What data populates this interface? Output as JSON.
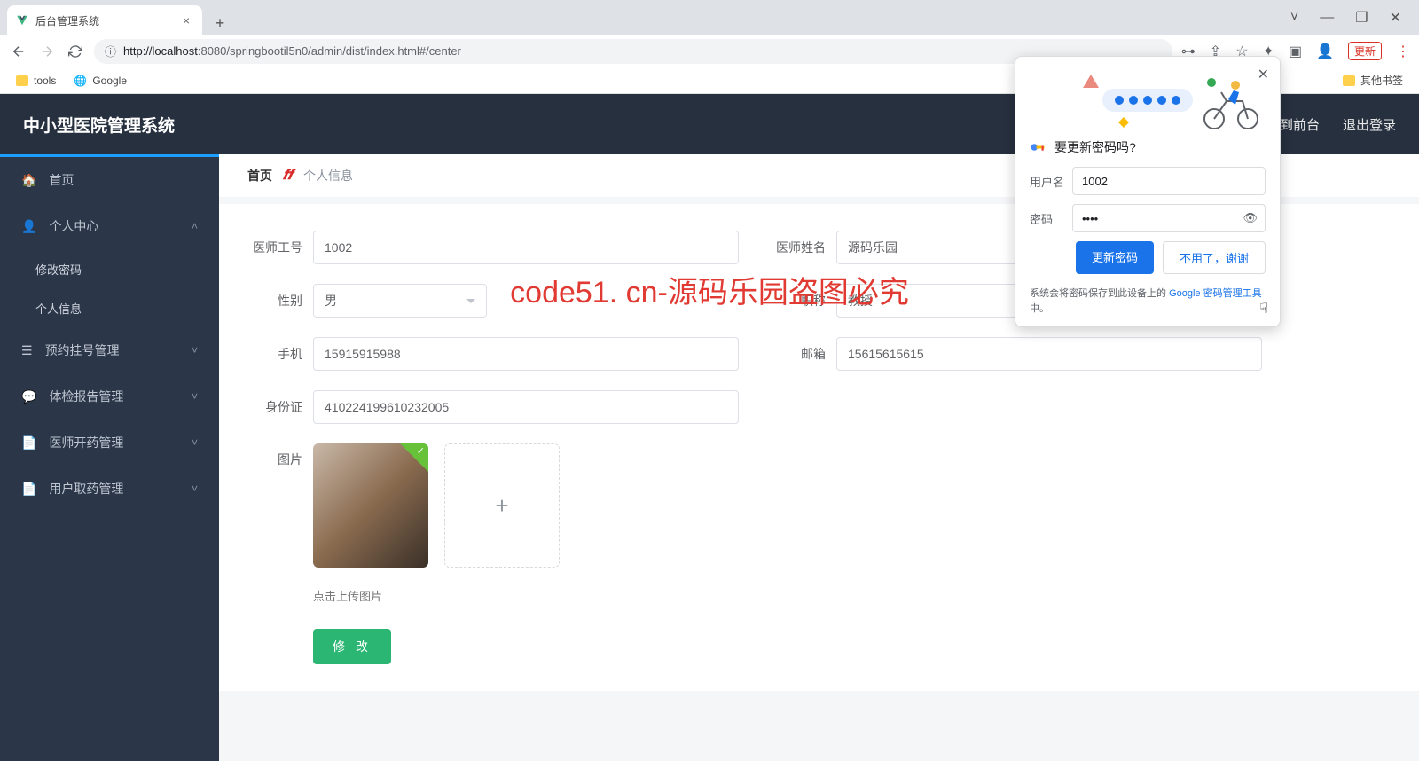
{
  "browser": {
    "tab_title": "后台管理系统",
    "url_scheme": "http://",
    "url_host": "localhost",
    "url_port_path": ":8080/springbootil5n0/admin/dist/index.html#/center",
    "update_chip": "更新",
    "bookmarks": {
      "tools": "tools",
      "google": "Google",
      "other": "其他书签"
    },
    "window": {
      "min": "—",
      "max": "❐",
      "close": "✕",
      "drop": "˅"
    }
  },
  "header": {
    "title": "中小型医院管理系统",
    "to_front": "到前台",
    "logout": "退出登录"
  },
  "sidebar": [
    {
      "icon": "home",
      "label": "首页",
      "chev": "",
      "sub": []
    },
    {
      "icon": "user",
      "label": "个人中心",
      "chev": "˄",
      "sub": [
        "修改密码",
        "个人信息"
      ]
    },
    {
      "icon": "list",
      "label": "预约挂号管理",
      "chev": "˅",
      "sub": []
    },
    {
      "icon": "chat",
      "label": "体检报告管理",
      "chev": "˅",
      "sub": []
    },
    {
      "icon": "doc",
      "label": "医师开药管理",
      "chev": "˅",
      "sub": []
    },
    {
      "icon": "doc",
      "label": "用户取药管理",
      "chev": "˅",
      "sub": []
    }
  ],
  "crumb": {
    "home": "首页",
    "logo": "𝒇𝒇",
    "current": "个人信息"
  },
  "form": {
    "labels": {
      "id": "医师工号",
      "name": "医师姓名",
      "gender": "性别",
      "title": "职称",
      "phone": "手机",
      "email": "邮箱",
      "idcard": "身份证",
      "photo": "图片"
    },
    "values": {
      "id": "1002",
      "name": "源码乐园",
      "gender": "男",
      "title": "教授",
      "phone": "15915915988",
      "email": "15615615615",
      "idcard": "410224199610232005"
    },
    "upload_hint": "点击上传图片",
    "submit": "修 改"
  },
  "popup": {
    "title": "要更新密码吗?",
    "user_label": "用户名",
    "user_value": "1002",
    "pass_label": "密码",
    "pass_value": "••••",
    "btn_update": "更新密码",
    "btn_no": "不用了，谢谢",
    "footer_pre": "系统会将密码保存到此设备上的 ",
    "footer_link": "Google 密码管理工具",
    "footer_post": "中。"
  },
  "watermark": "code51. cn-源码乐园盗图必究",
  "wm_bg": "code51.cn"
}
